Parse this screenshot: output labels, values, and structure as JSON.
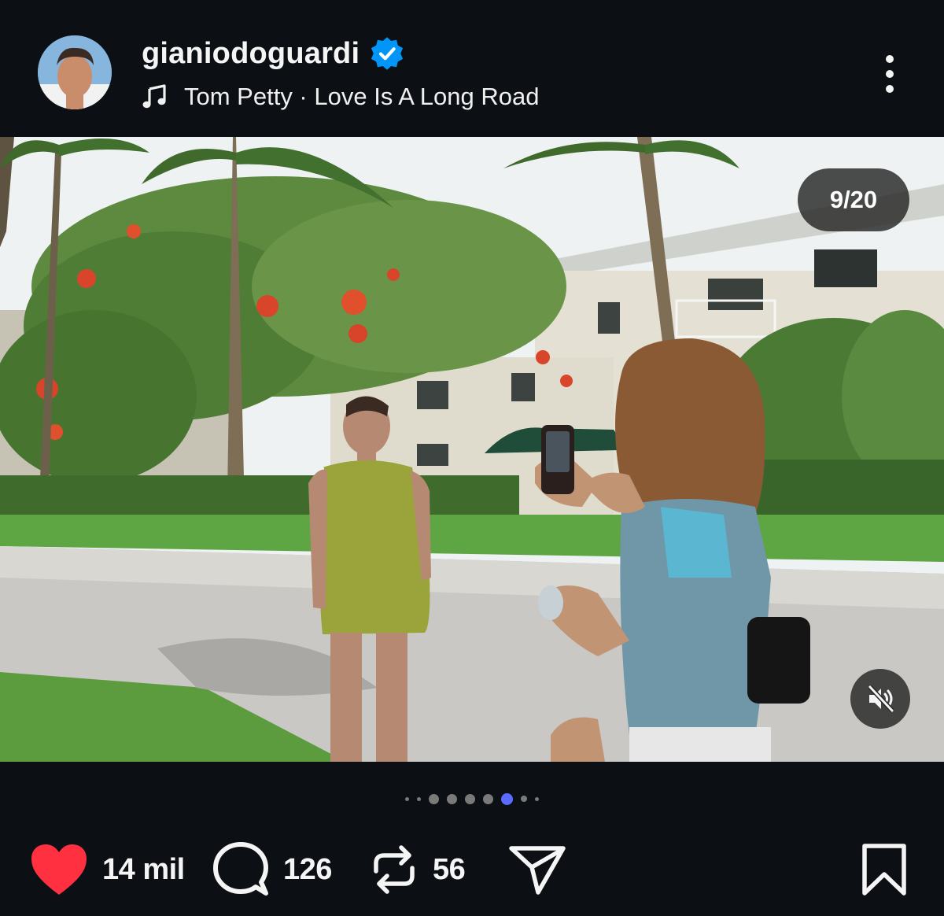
{
  "post": {
    "username": "gianiodoguardi",
    "verified": true,
    "music": {
      "artist": "Tom Petty",
      "separator": " · ",
      "song": "Love Is A Long Road",
      "label": "Tom Petty · Love Is A Long Road"
    },
    "counter": "9/20",
    "carousel": {
      "current": 9,
      "total": 20,
      "visible_dots": 8,
      "active_dot_index": 6
    }
  },
  "actions": {
    "likes": "14 mil",
    "comments": "126",
    "reposts": "56"
  },
  "colors": {
    "background": "#0c1014",
    "like_red": "#ff3040",
    "verified_blue": "#0095f6",
    "active_dot": "#5b6bff"
  },
  "icons": [
    "verified-badge-icon",
    "music-note-icon",
    "more-options-icon",
    "mute-icon",
    "heart-icon",
    "comment-icon",
    "repost-icon",
    "share-icon",
    "bookmark-icon"
  ]
}
